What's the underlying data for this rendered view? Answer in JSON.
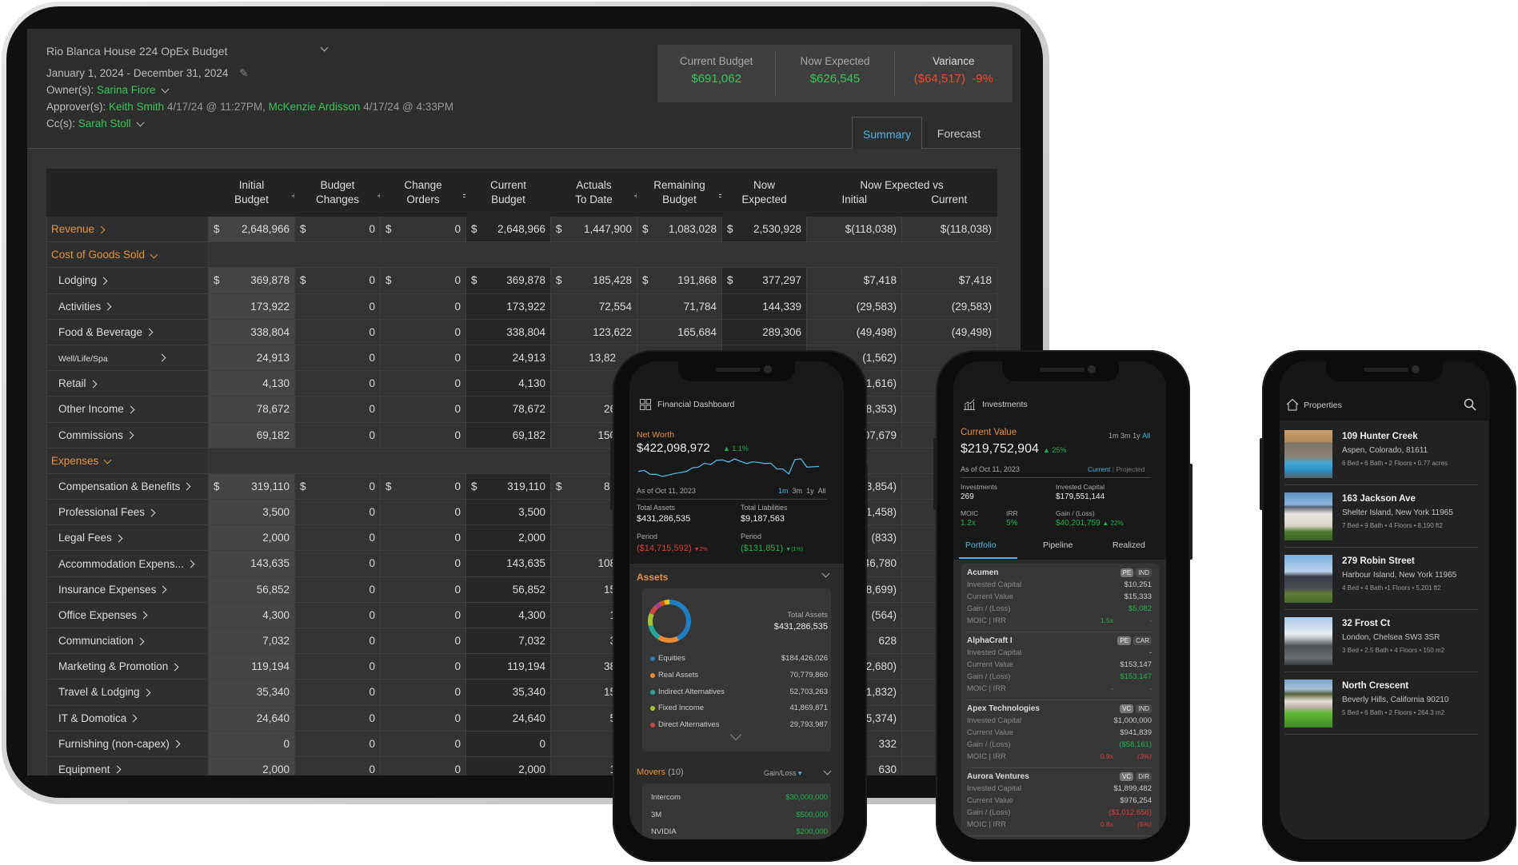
{
  "budget": {
    "title": "Rio Blanca House 224 OpEx Budget",
    "date_range": "January 1, 2024 - December 31, 2024",
    "owner_label": "Owner(s):",
    "owner": "Sarina Fiore",
    "approvers_label": "Approver(s):",
    "approvers": [
      {
        "name": "Keith Smith",
        "time": "4/17/24 @ 11:27PM,"
      },
      {
        "name": "McKenzie Ardisson",
        "time": "4/17/24 @ 4:33PM"
      }
    ],
    "cc_label": "Cc(s):",
    "cc": "Sarah Stoll",
    "kpis": [
      {
        "label": "Current Budget",
        "value": "$691,062"
      },
      {
        "label": "Now Expected",
        "value": "$626,545"
      },
      {
        "label": "Variance",
        "value": "($64,517)",
        "pct": "-9%"
      }
    ],
    "tabs": [
      "Summary",
      "Forecast"
    ],
    "active_tab": "Summary",
    "table": {
      "columns": [
        [
          "Initial",
          "Budget"
        ],
        [
          "Budget",
          "Changes"
        ],
        [
          "Change",
          "Orders"
        ],
        [
          "Current",
          "Budget"
        ],
        [
          "Actuals",
          "To Date"
        ],
        [
          "Remaining",
          "Budget"
        ],
        [
          "Now",
          "Expected"
        ]
      ],
      "operators": [
        "+",
        "+",
        "=",
        "",
        "+",
        "="
      ],
      "compare_header": "Now Expected vs",
      "compare_columns": [
        "Initial",
        "Current"
      ],
      "rows": [
        {
          "label": "Revenue",
          "kind": "group",
          "expand": "right",
          "dollar": true,
          "values": [
            "2,648,966",
            "0",
            "0",
            "2,648,966",
            "1,447,900",
            "1,083,028",
            "2,530,928",
            "$(118,038)",
            "$(118,038)"
          ]
        },
        {
          "label": "Cost of Goods Sold",
          "kind": "header",
          "expand": "down"
        },
        {
          "label": "Lodging",
          "kind": "item",
          "dollar": true,
          "values": [
            "369,878",
            "0",
            "0",
            "369,878",
            "185,428",
            "191,868",
            "377,297",
            "$7,418",
            "$7,418"
          ]
        },
        {
          "label": "Activities",
          "kind": "item",
          "values": [
            "173,922",
            "0",
            "0",
            "173,922",
            "72,554",
            "71,784",
            "144,339",
            "(29,583)",
            "(29,583)"
          ]
        },
        {
          "label": "Food & Beverage",
          "kind": "item",
          "values": [
            "338,804",
            "0",
            "0",
            "338,804",
            "123,622",
            "165,684",
            "289,306",
            "(49,498)",
            "(49,498)"
          ]
        },
        {
          "label": "Well/Life/Spa",
          "kind": "item",
          "small": true,
          "values": [
            "24,913",
            "0",
            "0",
            "24,913",
            "13,82",
            "",
            "",
            "(1,562)",
            ""
          ]
        },
        {
          "label": "Retail",
          "kind": "item",
          "values": [
            "4,130",
            "0",
            "0",
            "4,130",
            "",
            "",
            "",
            "(1,616)",
            ""
          ]
        },
        {
          "label": "Other Income",
          "kind": "item",
          "values": [
            "78,672",
            "0",
            "0",
            "78,672",
            "26",
            "",
            "",
            "(18,353)",
            ""
          ]
        },
        {
          "label": "Commissions",
          "kind": "item",
          "values": [
            "69,182",
            "0",
            "0",
            "69,182",
            "150",
            "",
            "",
            "107,679",
            ""
          ]
        },
        {
          "label": "Expenses",
          "kind": "header",
          "expand": "down"
        },
        {
          "label": "Compensation & Benefits",
          "kind": "item",
          "dollar": true,
          "values": [
            "319,110",
            "0",
            "0",
            "319,110",
            "88",
            "",
            "",
            "(33,854)",
            ""
          ]
        },
        {
          "label": "Professional Fees",
          "kind": "item",
          "values": [
            "3,500",
            "0",
            "0",
            "3,500",
            "",
            "",
            "",
            "(1,458)",
            ""
          ]
        },
        {
          "label": "Legal Fees",
          "kind": "item",
          "values": [
            "2,000",
            "0",
            "0",
            "2,000",
            "",
            "",
            "",
            "(833)",
            ""
          ]
        },
        {
          "label": "Accommodation Expens...",
          "kind": "item",
          "values": [
            "143,635",
            "0",
            "0",
            "143,635",
            "108",
            "",
            "",
            "46,780",
            ""
          ]
        },
        {
          "label": "Insurance Expenses",
          "kind": "item",
          "values": [
            "56,852",
            "0",
            "0",
            "56,852",
            "15",
            "",
            "",
            "(8,699)",
            ""
          ]
        },
        {
          "label": "Office Expenses",
          "kind": "item",
          "values": [
            "4,300",
            "0",
            "0",
            "4,300",
            "1",
            "",
            "",
            "(564)",
            ""
          ]
        },
        {
          "label": "Communciation",
          "kind": "item",
          "values": [
            "7,032",
            "0",
            "0",
            "7,032",
            "3",
            "",
            "",
            "628",
            ""
          ]
        },
        {
          "label": "Marketing & Promotion",
          "kind": "item",
          "values": [
            "119,194",
            "0",
            "0",
            "119,194",
            "38",
            "",
            "",
            "(12,680)",
            ""
          ]
        },
        {
          "label": "Travel & Lodging",
          "kind": "item",
          "values": [
            "35,340",
            "0",
            "0",
            "35,340",
            "15",
            "",
            "",
            "(1,832)",
            ""
          ]
        },
        {
          "label": "IT & Domotica",
          "kind": "item",
          "values": [
            "24,640",
            "0",
            "0",
            "24,640",
            "5",
            "",
            "",
            "(5,374)",
            ""
          ]
        },
        {
          "label": "Furnishing (non-capex)",
          "kind": "item",
          "values": [
            "0",
            "0",
            "0",
            "0",
            "",
            "",
            "",
            "332",
            ""
          ]
        },
        {
          "label": "Equipment",
          "kind": "item",
          "values": [
            "2,000",
            "0",
            "0",
            "2,000",
            "1",
            "",
            "",
            "630",
            ""
          ]
        }
      ]
    }
  },
  "dashboard": {
    "title": "Financial Dashboard",
    "net_worth_label": "Net Worth",
    "net_worth": "$422,098,972",
    "net_worth_change": "▲ 1.1%",
    "sparkline": [
      25,
      28,
      17,
      17,
      11,
      15,
      19,
      22,
      25,
      35,
      37,
      48,
      44,
      56,
      57,
      51,
      60,
      53,
      47,
      52,
      50,
      47,
      48,
      32,
      32,
      18,
      58,
      60,
      37,
      38,
      39
    ],
    "as_of": "As of Oct 11, 2023",
    "ranges": [
      "1m",
      "3m",
      "1y",
      "All"
    ],
    "active_range": "1m",
    "total_assets_label": "Total Assets",
    "total_assets": "$431,286,535",
    "total_liabilities_label": "Total Liabilities",
    "total_liabilities": "$9,187,563",
    "period_label": "Period",
    "assets_period": "($14,715,592)",
    "assets_period_pct": "▼2%",
    "liabilities_period": "($131,851)",
    "liabilities_period_pct": "▼(1%)",
    "assets_title": "Assets",
    "assets_total_label": "Total Assets",
    "assets_total": "$431,286,535",
    "asset_classes": [
      {
        "name": "Equities",
        "value": "$184,426,026",
        "amount": 184426026,
        "color": "#1f7fc4"
      },
      {
        "name": "Real Assets",
        "value": "70,779,860",
        "amount": 70779860,
        "color": "#f08a32"
      },
      {
        "name": "Indirect Alternatives",
        "value": "52,703,263",
        "amount": 52703263,
        "color": "#22a79a"
      },
      {
        "name": "Fixed Income",
        "value": "41,869,871",
        "amount": 41869871,
        "color": "#a3c531"
      },
      {
        "name": "Direct Alternatives",
        "value": "29,793,987",
        "amount": 29793987,
        "color": "#d04444"
      }
    ],
    "other_segment_colors": [
      "#a23c96",
      "#d0561f",
      "#f2c21a"
    ],
    "movers_title": "Movers",
    "movers_count": "(10)",
    "movers_sort": "Gain/Loss",
    "movers": [
      {
        "name": "Intercom",
        "value": "$30,000,000"
      },
      {
        "name": "3M",
        "value": "$500,000"
      },
      {
        "name": "NVIDIA",
        "value": "$200,000"
      }
    ]
  },
  "investments": {
    "title": "Investments",
    "current_value_label": "Current Value",
    "current_value": "$219,752,904",
    "current_value_change": "▲ 25%",
    "ranges": [
      "1m",
      "3m",
      "1y",
      "All"
    ],
    "active_range": "All",
    "as_of": "As of Oct 11, 2023",
    "views": [
      "Current",
      "Projected"
    ],
    "active_view": "Current",
    "investments_label": "Investments",
    "investments_count": "269",
    "invested_capital_label": "Invested Capital",
    "invested_capital": "$179,551,144",
    "moic_label": "MOIC",
    "moic": "1.2x",
    "irr_label": "IRR",
    "irr": "5%",
    "gain_label": "Gain / (Loss)",
    "gain": "$40,201,759",
    "gain_pct": "▲ 22%",
    "tabs": [
      "Portfolio",
      "Pipeline",
      "Realized"
    ],
    "active_tab": "Portfolio",
    "row_labels": [
      "Invested Capital",
      "Current Value",
      "Gain / (Loss)",
      "MOIC  |  IRR"
    ],
    "items": [
      {
        "name": "Acumen",
        "badges": [
          "PE",
          "IND"
        ],
        "invested": "$10,251",
        "current": "$15,333",
        "gain": "$5,082",
        "gain_tone": "pos",
        "moic": "1.5x",
        "irr": "-",
        "moic_tone": "pos"
      },
      {
        "name": "AlphaCraft I",
        "badges": [
          "PE",
          "CAR"
        ],
        "invested": "-",
        "current": "$153,147",
        "gain": "$153,147",
        "gain_tone": "pos",
        "moic": "-",
        "irr": "-",
        "moic_tone": "neutral"
      },
      {
        "name": "Apex Technologies",
        "badges": [
          "VC",
          "IND"
        ],
        "invested": "$1,000,000",
        "current": "$941,839",
        "gain": "($58,161)",
        "gain_tone": "pos",
        "moic": "0.9x",
        "irr": "(3%)",
        "moic_tone": "neg"
      },
      {
        "name": "Aurora Ventures",
        "badges": [
          "VC",
          "DIR"
        ],
        "invested": "$1,899,482",
        "current": "$976,254",
        "gain": "($1,012,656)",
        "gain_tone": "neg",
        "moic": "0.8x",
        "irr": "(6%)",
        "moic_tone": "neg"
      }
    ]
  },
  "properties": {
    "title": "Properties",
    "items": [
      {
        "name": "109 Hunter Creek",
        "address": "Aspen, Colorado, 81611",
        "specs": "6 Bed • 6 Bath • 2 Floors • 0.77 acres"
      },
      {
        "name": "163 Jackson Ave",
        "address": "Shelter Island, New York 11965",
        "specs": "7 Bed • 9 Bath • 4 Floors • 8,190 ft2"
      },
      {
        "name": "279 Robin Street",
        "address": "Harbour Island, New York 11965",
        "specs": "4 Bed • 4 Bath •1 Floors • 5,201 ft2"
      },
      {
        "name": "32 Frost Ct",
        "address": "London, Chelsea SW3 3SR",
        "specs": "3 Bed • 2.5 Bath • 4 Floors • 150 m2"
      },
      {
        "name": "North Crescent",
        "address": "Beverly Hills, California 90210",
        "specs": "5 Bed • 6 Bath • 2 Floors • 264.3 m2"
      }
    ]
  }
}
